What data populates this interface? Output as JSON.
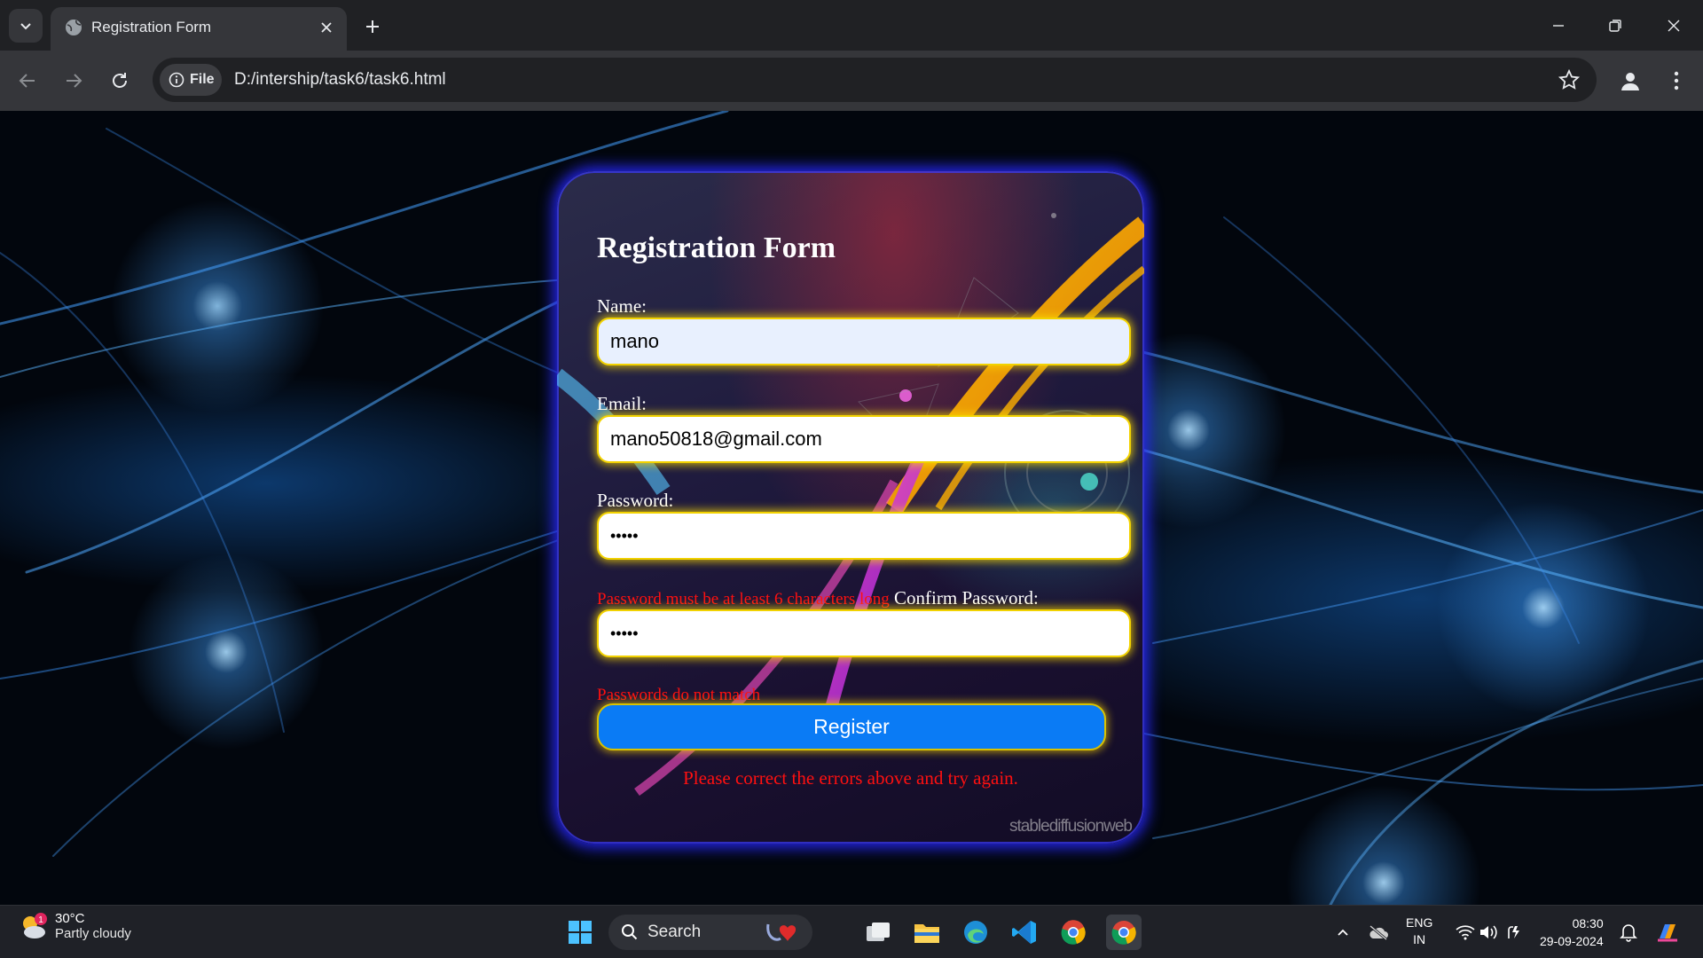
{
  "browser": {
    "tab_title": "Registration Form",
    "chip_label": "File",
    "url": "D:/intership/task6/task6.html",
    "icons": [
      "tab-search-icon",
      "globe-icon",
      "close-icon",
      "plus-icon",
      "minimize-icon",
      "restore-icon",
      "close-window-icon",
      "back-icon",
      "forward-icon",
      "reload-icon",
      "info-icon",
      "star-icon",
      "profile-icon",
      "kebab-menu-icon"
    ]
  },
  "form": {
    "title": "Registration Form",
    "name_label": "Name:",
    "name_value": "mano",
    "email_label": "Email:",
    "email_value": "mano50818@gmail.com",
    "password_label": "Password:",
    "password_value": "•••••",
    "password_error": "Password must be at least 6 characters long",
    "confirm_label": "Confirm Password:",
    "confirm_value": "•••••",
    "confirm_error": "Passwords do not match",
    "register_label": "Register",
    "form_error": "Please correct the errors above and try again.",
    "watermark": "stablediffusionweb"
  },
  "taskbar": {
    "temperature": "30°C",
    "weather": "Partly cloudy",
    "weather_badge": "1",
    "search_label": "Search",
    "lang_top": "ENG",
    "lang_bottom": "IN",
    "time": "08:30",
    "date": "29-09-2024"
  },
  "colors": {
    "accent_button": "#0a7bf5",
    "field_glow": "#f2d200",
    "error_text": "#ff1010",
    "card_border": "#2828ff"
  }
}
